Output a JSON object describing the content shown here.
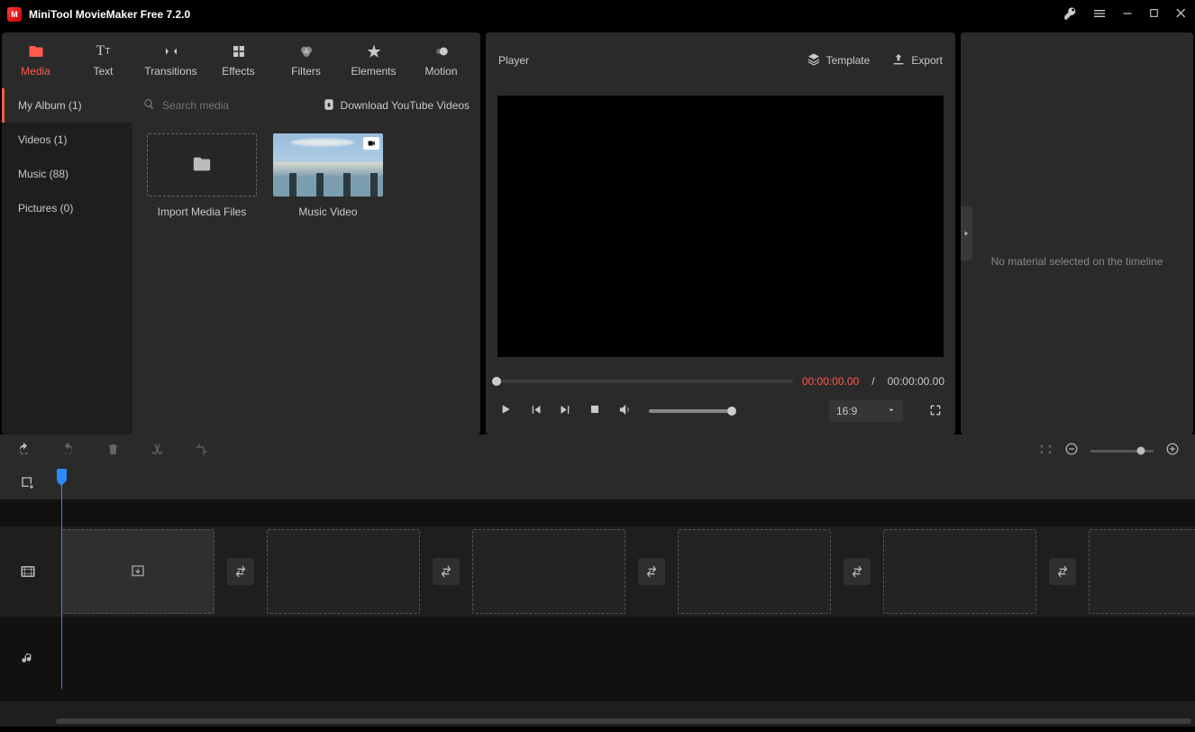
{
  "app": {
    "title": "MiniTool MovieMaker Free 7.2.0"
  },
  "mainTabs": {
    "media": "Media",
    "text": "Text",
    "transitions": "Transitions",
    "effects": "Effects",
    "filters": "Filters",
    "elements": "Elements",
    "motion": "Motion"
  },
  "mediaSidebar": {
    "album": "My Album (1)",
    "videos": "Videos (1)",
    "music": "Music (88)",
    "pictures": "Pictures (0)"
  },
  "mediaSearch": {
    "placeholder": "Search media"
  },
  "mediaDownloadLink": "Download YouTube Videos",
  "mediaItems": {
    "import": "Import Media Files",
    "clip1": "Music Video"
  },
  "player": {
    "title": "Player",
    "template": "Template",
    "export": "Export",
    "currentTime": "00:00:00.00",
    "separator": "/",
    "totalTime": "00:00:00.00",
    "ratio": "16:9"
  },
  "props": {
    "empty": "No material selected on the timeline"
  }
}
